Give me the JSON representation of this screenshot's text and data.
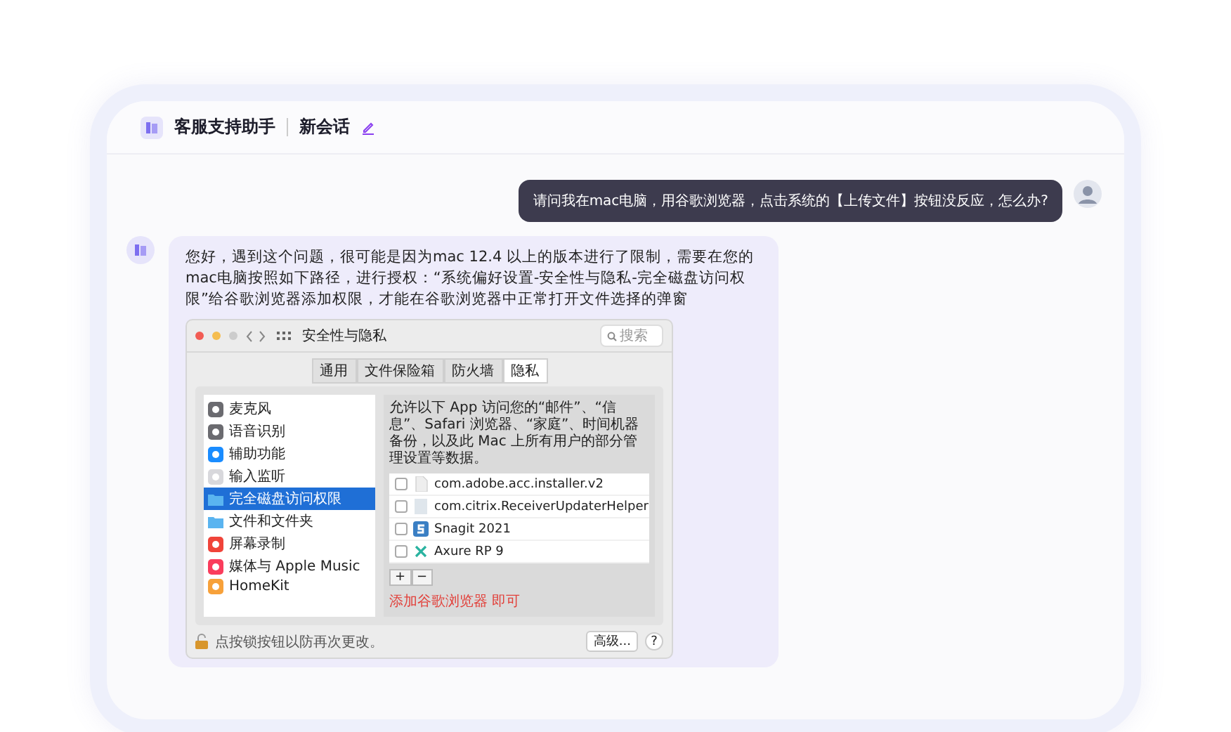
{
  "header": {
    "app_name": "客服支持助手",
    "session_title": "新会话"
  },
  "messages": [
    {
      "kind": "user",
      "text": "请问我在mac电脑，用谷歌浏览器，点击系统的【上传文件】按钮没反应，怎么办?"
    },
    {
      "kind": "assistant",
      "text": "您好，遇到这个问题，很可能是因为mac 12.4 以上的版本进行了限制，需要在您的mac电脑按照如下路径，进行授权：“系统偏好设置-安全性与隐私-完全磁盘访问权限”给谷歌浏览器添加权限，才能在谷歌浏览器中正常打开文件选择的弹窗",
      "screenshot": {
        "title": "安全性与隐私",
        "search_placeholder": "搜索",
        "tabs": [
          {
            "label": "通用",
            "selected": false
          },
          {
            "label": "文件保险箱",
            "selected": false
          },
          {
            "label": "防火墙",
            "selected": false
          },
          {
            "label": "隐私",
            "selected": true
          }
        ],
        "sidebar": [
          {
            "label": "麦克风",
            "kind": "mic",
            "selected": false
          },
          {
            "label": "语音识别",
            "kind": "speech",
            "selected": false
          },
          {
            "label": "辅助功能",
            "kind": "accessibility",
            "selected": false
          },
          {
            "label": "输入监听",
            "kind": "keyboard",
            "selected": false
          },
          {
            "label": "完全磁盘访问权限",
            "kind": "folder",
            "selected": true
          },
          {
            "label": "文件和文件夹",
            "kind": "folder",
            "selected": false
          },
          {
            "label": "屏幕录制",
            "kind": "record",
            "selected": false
          },
          {
            "label": "媒体与 Apple Music",
            "kind": "music",
            "selected": false
          },
          {
            "label": "HomeKit",
            "kind": "home",
            "selected": false
          }
        ],
        "description": "允许以下 App 访问您的“邮件”、“信息”、Safari 浏览器、“家庭”、时间机器备份，以及此 Mac 上所有用户的部分管理设置等数据。",
        "apps": [
          {
            "name": "com.adobe.acc.installer.v2",
            "kind": "file",
            "checked": false
          },
          {
            "name": "com.citrix.ReceiverUpdaterHelper",
            "kind": "doc",
            "checked": false
          },
          {
            "name": "Snagit 2021",
            "kind": "snagit",
            "checked": false
          },
          {
            "name": "Axure RP 9",
            "kind": "axure",
            "checked": false
          }
        ],
        "add_label": "+",
        "remove_label": "−",
        "annotation": "添加谷歌浏览器 即可",
        "lock_text": "点按锁按钮以防再次更改。",
        "advanced_button": "高级...",
        "help_button": "?"
      }
    }
  ]
}
